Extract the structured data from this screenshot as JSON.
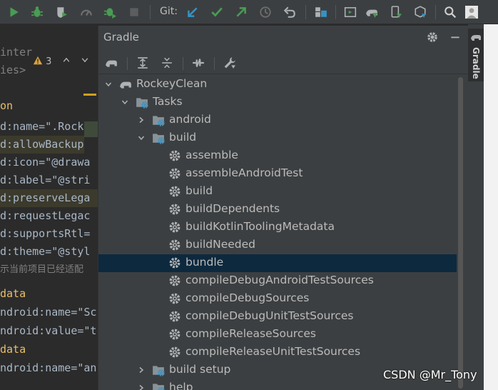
{
  "toolbar": {
    "git_label": "Git:",
    "icons": [
      "run-icon",
      "debug-icon",
      "coverage-icon",
      "profiler-icon",
      "attach-debugger-icon",
      "stop-icon",
      "git-update-icon",
      "git-commit-icon",
      "git-push-icon",
      "history-icon",
      "rollback-icon",
      "project-structure-icon",
      "device-manager-icon",
      "gradle-sync-icon",
      "avd-manager-icon",
      "sdk-manager-icon",
      "search-icon",
      "account-icon"
    ]
  },
  "editor": {
    "warning_count": "3",
    "lines": [
      {
        "text": "inter",
        "color": "#808080"
      },
      {
        "text": "ies>",
        "color": "#808080"
      },
      {
        "text": "",
        "color": "#a9b7c6"
      },
      {
        "text": "on",
        "color": "#e8bf6a"
      },
      {
        "text": "d:name=\".Rocke",
        "color": "#a9b7c6"
      },
      {
        "text": "d:allowBackup",
        "color": "#a9b7c6"
      },
      {
        "text": "d:icon=\"@drawa",
        "color": "#a9b7c6"
      },
      {
        "text": "d:label=\"@stri",
        "color": "#a9b7c6"
      },
      {
        "text": "d:preserveLega",
        "color": "#a9b7c6"
      },
      {
        "text": "d:requestLegac",
        "color": "#a9b7c6"
      },
      {
        "text": "d:supportsRtl=",
        "color": "#a9b7c6"
      },
      {
        "text": "d:theme=\"@styl",
        "color": "#a9b7c6"
      },
      {
        "text": "示当前项目已经适配",
        "color": "#808080"
      },
      {
        "text": "data",
        "color": "#e8bf6a"
      },
      {
        "text": "ndroid:name=\"Sc",
        "color": "#a9b7c6"
      },
      {
        "text": "ndroid:value=\"t",
        "color": "#a9b7c6"
      },
      {
        "text": "data",
        "color": "#e8bf6a"
      },
      {
        "text": "ndroid:name=\"an",
        "color": "#a9b7c6"
      }
    ]
  },
  "gradle_panel": {
    "title": "Gradle",
    "vertical_tab_label": "Gradle",
    "tree": [
      {
        "label": "RockeyClean",
        "level": 0,
        "arrow": "down",
        "icon": "elephant-icon"
      },
      {
        "label": "Tasks",
        "level": 1,
        "arrow": "down",
        "icon": "folder-gear-icon"
      },
      {
        "label": "android",
        "level": 2,
        "arrow": "right",
        "icon": "folder-gear-icon"
      },
      {
        "label": "build",
        "level": 2,
        "arrow": "down",
        "icon": "folder-gear-icon"
      },
      {
        "label": "assemble",
        "level": 3,
        "arrow": "",
        "icon": "gear-icon"
      },
      {
        "label": "assembleAndroidTest",
        "level": 3,
        "arrow": "",
        "icon": "gear-icon"
      },
      {
        "label": "build",
        "level": 3,
        "arrow": "",
        "icon": "gear-icon"
      },
      {
        "label": "buildDependents",
        "level": 3,
        "arrow": "",
        "icon": "gear-icon"
      },
      {
        "label": "buildKotlinToolingMetadata",
        "level": 3,
        "arrow": "",
        "icon": "gear-icon"
      },
      {
        "label": "buildNeeded",
        "level": 3,
        "arrow": "",
        "icon": "gear-icon"
      },
      {
        "label": "bundle",
        "level": 3,
        "arrow": "",
        "icon": "gear-icon",
        "selected": true
      },
      {
        "label": "compileDebugAndroidTestSources",
        "level": 3,
        "arrow": "",
        "icon": "gear-icon"
      },
      {
        "label": "compileDebugSources",
        "level": 3,
        "arrow": "",
        "icon": "gear-icon"
      },
      {
        "label": "compileDebugUnitTestSources",
        "level": 3,
        "arrow": "",
        "icon": "gear-icon"
      },
      {
        "label": "compileReleaseSources",
        "level": 3,
        "arrow": "",
        "icon": "gear-icon"
      },
      {
        "label": "compileReleaseUnitTestSources",
        "level": 3,
        "arrow": "",
        "icon": "gear-icon"
      },
      {
        "label": "build setup",
        "level": 2,
        "arrow": "right",
        "icon": "folder-gear-icon"
      },
      {
        "label": "help",
        "level": 2,
        "arrow": "right",
        "icon": "folder-gear-icon"
      }
    ]
  },
  "watermark": "CSDN @Mr_Tony",
  "colors": {
    "selection": "#0d293e",
    "gear": "#afb1b3",
    "folder": "#87939a",
    "gear_blue": "#3592c4"
  }
}
